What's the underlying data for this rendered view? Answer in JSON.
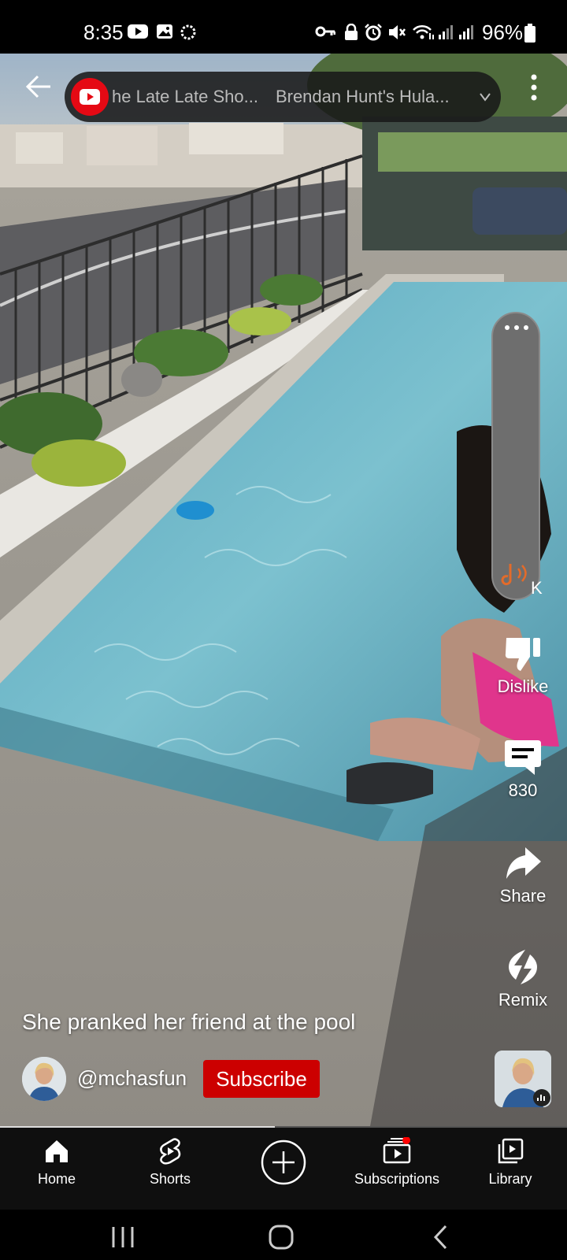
{
  "status_bar": {
    "time": "8:35",
    "battery": "96%",
    "icons": [
      "youtube-icon",
      "gallery-icon",
      "loading-icon",
      "key-icon",
      "lock-icon",
      "alarm-icon",
      "mute-icon",
      "wifi-icon",
      "signal-icon"
    ]
  },
  "top_bar": {
    "back_icon": "arrow-left-icon",
    "now_playing": [
      "he Late Late Sho...",
      "Brendan Hunt's Hula..."
    ],
    "more_icon": "more-vert-icon"
  },
  "volume": {
    "icon": "music-note-icon"
  },
  "actions": {
    "like_count_fragment": "K",
    "dislike_label": "Dislike",
    "comments_count": "830",
    "share_label": "Share",
    "remix_label": "Remix"
  },
  "video": {
    "title": "She pranked her friend at the pool",
    "channel_handle": "@mchasfun",
    "subscribe_label": "Subscribe",
    "progress": 0.485
  },
  "bottom_nav": {
    "items": [
      {
        "label": "Home",
        "icon": "home-icon"
      },
      {
        "label": "Shorts",
        "icon": "shorts-icon"
      },
      {
        "label": "",
        "icon": "create-icon"
      },
      {
        "label": "Subscriptions",
        "icon": "subscriptions-icon"
      },
      {
        "label": "Library",
        "icon": "library-icon"
      }
    ]
  },
  "colors": {
    "subscribe_red": "#cc0000",
    "pool_water": "#6fb8c9",
    "notification_dot": "#ff0000"
  }
}
